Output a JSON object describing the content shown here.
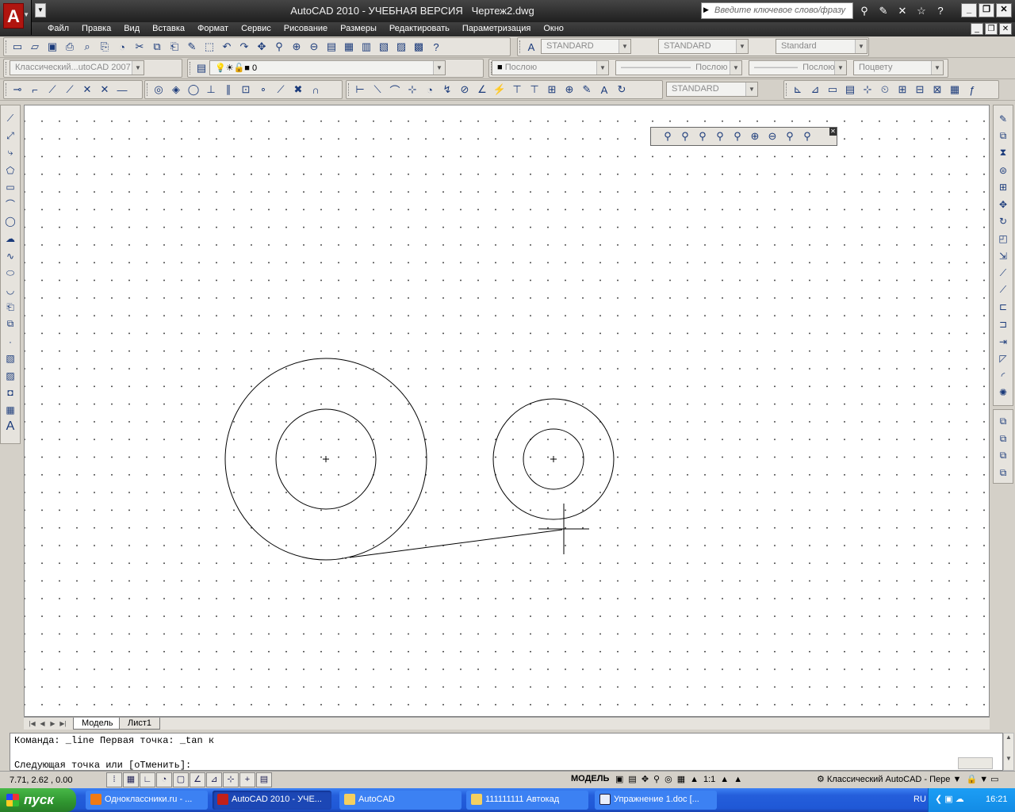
{
  "title": {
    "app_name": "AutoCAD 2010 - УЧЕБНАЯ ВЕРСИЯ",
    "document": "Чертеж2.dwg",
    "search_placeholder": "Введите ключевое слово/фразу"
  },
  "menu": [
    "Файл",
    "Правка",
    "Вид",
    "Вставка",
    "Формат",
    "Сервис",
    "Рисование",
    "Размеры",
    "Редактировать",
    "Параметризация",
    "Окно"
  ],
  "toolbar": {
    "text_style": "STANDARD",
    "dim_style": "STANDARD",
    "table_style": "Standard",
    "workspace": "Классический...utoCAD 2007",
    "layer": "0",
    "color": "Послою",
    "linetype": "Послою",
    "lineweight": "Послою",
    "plotstyle": "Поцвету",
    "mleader_style": "STANDARD"
  },
  "tabs": [
    "Модель",
    "Лист1"
  ],
  "command": {
    "line1": "Команда: _line Первая точка: _tan к",
    "line2": "Следующая точка или [оТменить]:"
  },
  "status": {
    "coords": "7.71, 2.62 , 0.00",
    "model": "МОДЕЛЬ",
    "scale": "1:1",
    "workspace": "Классический AutoCAD - Пере"
  },
  "taskbar": {
    "start": "пуск",
    "tasks": [
      "Одноклассники.ru - ...",
      "AutoCAD 2010 - УЧЕ...",
      "AutoCAD",
      "111111111 Автокад",
      "Упражнение 1.doc [..."
    ],
    "lang": "RU",
    "clock": "16:21"
  },
  "colors": {
    "canvas": "#ffffff",
    "taskbar": "#245edb",
    "start": "#2f942f",
    "title": "#2c2c2c"
  }
}
